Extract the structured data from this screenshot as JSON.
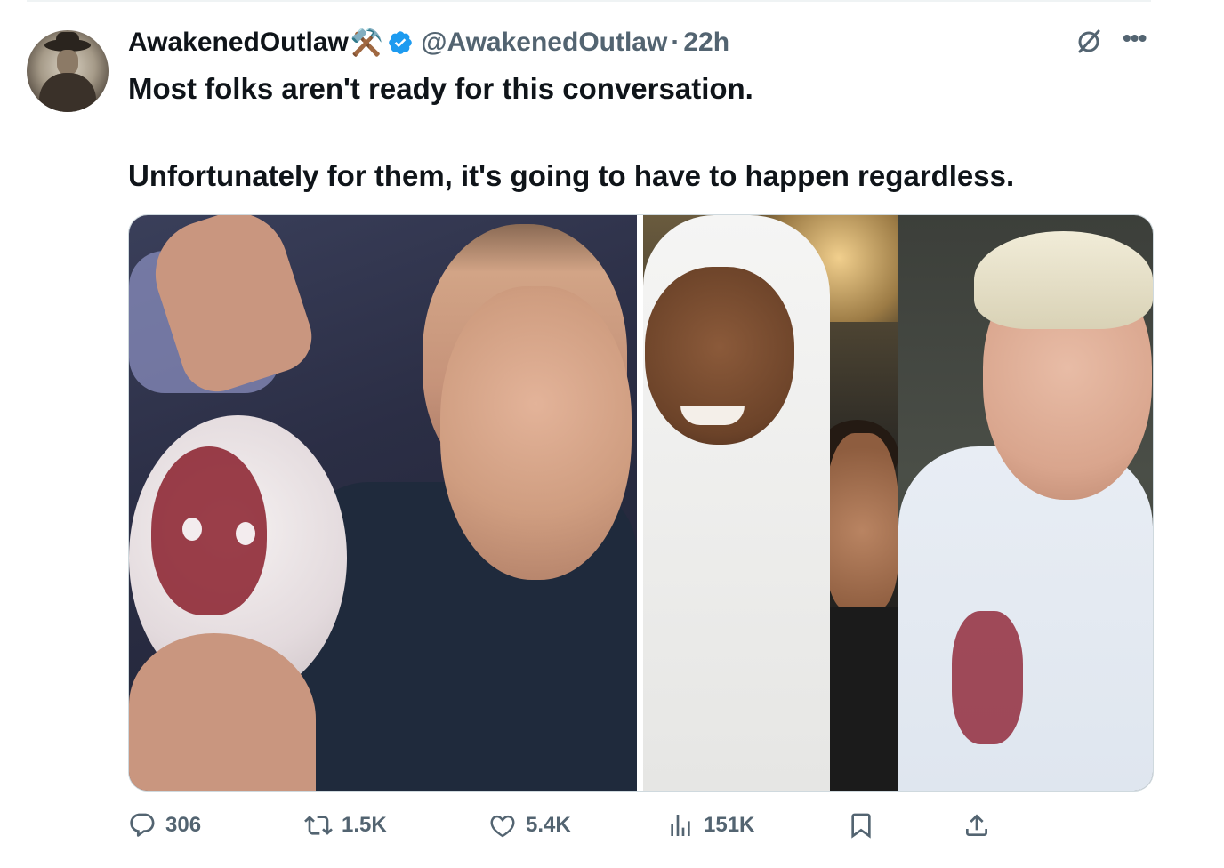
{
  "tweet": {
    "author_name": "AwakenedOutlaw",
    "author_emoji": "⚒️",
    "handle": "@AwakenedOutlaw",
    "separator": "·",
    "time": "22h",
    "text_lines": [
      "Most folks aren't ready for this conversation.",
      "Unfortunately for them, it's going to have to happen regardless."
    ]
  },
  "actions": {
    "replies": "306",
    "reposts": "1.5K",
    "likes": "5.4K",
    "views": "151K"
  },
  "colors": {
    "verified": "#1d9bf0",
    "muted": "#536471",
    "text": "#0f1419"
  },
  "icons": {
    "more": "more-icon",
    "grok": "grok-icon",
    "reply": "reply-icon",
    "repost": "repost-icon",
    "like": "heart-icon",
    "views": "views-icon",
    "bookmark": "bookmark-icon",
    "share": "share-icon"
  }
}
